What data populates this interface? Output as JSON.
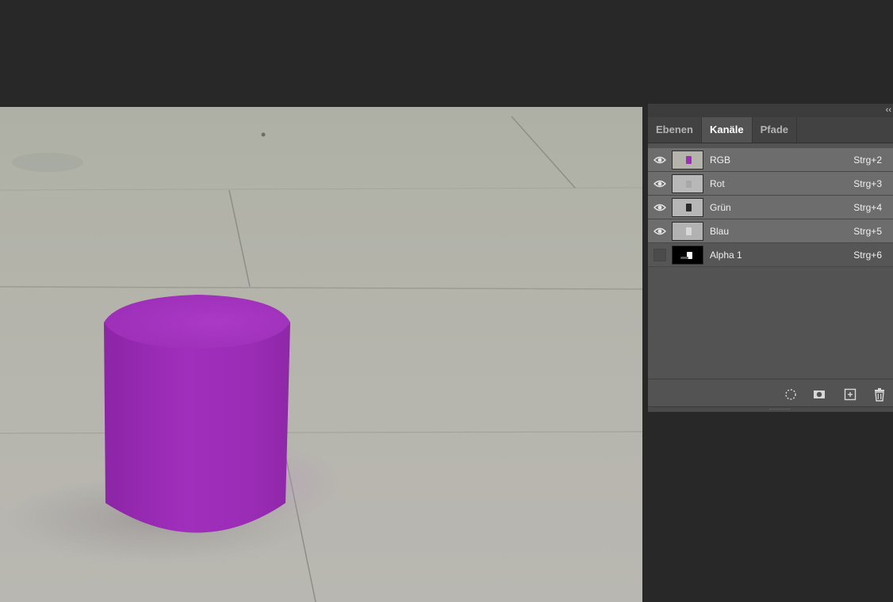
{
  "panel": {
    "tabs": [
      {
        "label": "Ebenen"
      },
      {
        "label": "Kanäle"
      },
      {
        "label": "Pfade"
      }
    ],
    "active_tab": "Kanäle",
    "channels": [
      {
        "name": "RGB",
        "shortcut": "Strg+2",
        "visible": true,
        "selected": true
      },
      {
        "name": "Rot",
        "shortcut": "Strg+3",
        "visible": true,
        "selected": true
      },
      {
        "name": "Grün",
        "shortcut": "Strg+4",
        "visible": true,
        "selected": true
      },
      {
        "name": "Blau",
        "shortcut": "Strg+5",
        "visible": true,
        "selected": true
      },
      {
        "name": "Alpha 1",
        "shortcut": "Strg+6",
        "visible": false,
        "selected": false
      }
    ],
    "bottom_tools": [
      {
        "icon": "load-selection-icon"
      },
      {
        "icon": "save-selection-icon"
      },
      {
        "icon": "new-channel-icon"
      },
      {
        "icon": "delete-channel-icon"
      }
    ]
  },
  "colors": {
    "cylinder": "#9c2fb8",
    "floor": "#b2b1a8",
    "app_background": "#282828",
    "panel_background": "#535353"
  }
}
